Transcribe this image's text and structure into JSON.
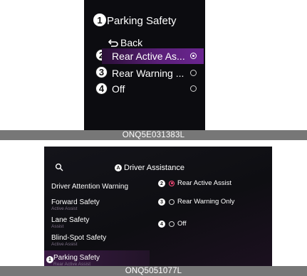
{
  "top": {
    "title_callout": "1",
    "title": "Parking Safety",
    "back_label": "Back",
    "items": [
      {
        "callout": "2",
        "label": "Rear Active As...",
        "selected": true
      },
      {
        "callout": "3",
        "label": "Rear Warning ...",
        "selected": false
      },
      {
        "callout": "4",
        "label": "Off",
        "selected": false
      }
    ],
    "caption": "ONQ5E031383L"
  },
  "bottom": {
    "title_callout": "A",
    "title": "Driver Assistance",
    "left_items": [
      {
        "label": "Driver Attention Warning",
        "sub": ""
      },
      {
        "label": "Forward Safety",
        "sub": "Active Assist"
      },
      {
        "label": "Lane Safety",
        "sub": "Assist"
      },
      {
        "label": "Blind-Spot Safety",
        "sub": "Active Assist"
      },
      {
        "label": "Parking Safety",
        "sub": "Rear Active Assist",
        "callout": "1"
      }
    ],
    "options": [
      {
        "callout": "2",
        "label": "Rear Active Assist",
        "selected": true
      },
      {
        "callout": "3",
        "label": "Rear Warning Only",
        "selected": false
      },
      {
        "callout": "4",
        "label": "Off",
        "selected": false
      }
    ],
    "caption": "ONQ5051077L"
  },
  "colors": {
    "selection_purple": "#5a1f78",
    "active_radio": "#ff4a7a",
    "caption_bar": "#777777"
  }
}
